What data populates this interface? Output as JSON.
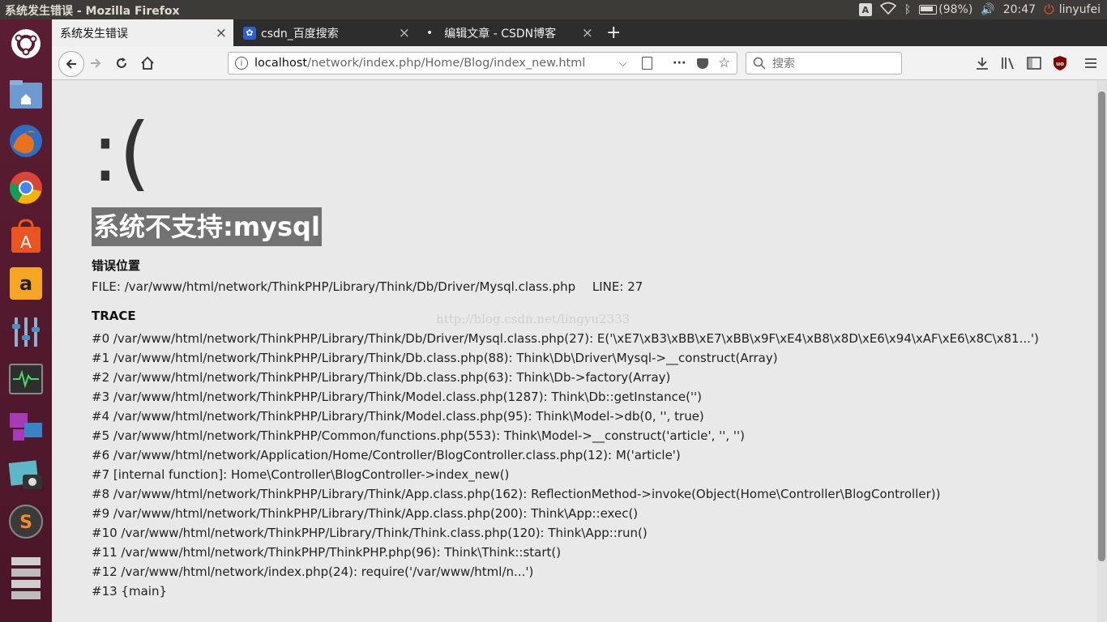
{
  "window": {
    "title": "系统发生错误 - Mozilla Firefox"
  },
  "tray": {
    "input": "A",
    "battery": "(98%)",
    "time": "20:47",
    "user": "linyufei"
  },
  "tabs": [
    {
      "label": "系统发生错误",
      "close": "×"
    },
    {
      "label": "csdn_百度搜索",
      "close": "×"
    },
    {
      "label": "编辑文章 - CSDN博客",
      "close": "×"
    }
  ],
  "newtab": "+",
  "url": {
    "host": "localhost",
    "path": "/network/index.php/Home/Blog/index_new.html"
  },
  "search": {
    "placeholder": "搜索"
  },
  "error": {
    "face": ":(",
    "message": "系统不支持:mysql",
    "location_label": "错误位置",
    "file": "FILE: /var/www/html/network/ThinkPHP/Library/Think/Db/Driver/Mysql.class.php",
    "line": "LINE: 27",
    "trace_label": "TRACE",
    "trace": [
      "#0 /var/www/html/network/ThinkPHP/Library/Think/Db/Driver/Mysql.class.php(27): E('\\xE7\\xB3\\xBB\\xE7\\xBB\\x9F\\xE4\\xB8\\x8D\\xE6\\x94\\xAF\\xE6\\x8C\\x81...')",
      "#1 /var/www/html/network/ThinkPHP/Library/Think/Db.class.php(88): Think\\Db\\Driver\\Mysql->__construct(Array)",
      "#2 /var/www/html/network/ThinkPHP/Library/Think/Db.class.php(63): Think\\Db->factory(Array)",
      "#3 /var/www/html/network/ThinkPHP/Library/Think/Model.class.php(1287): Think\\Db::getInstance('')",
      "#4 /var/www/html/network/ThinkPHP/Library/Think/Model.class.php(95): Think\\Model->db(0, '', true)",
      "#5 /var/www/html/network/ThinkPHP/Common/functions.php(553): Think\\Model->__construct('article', '', '')",
      "#6 /var/www/html/network/Application/Home/Controller/BlogController.class.php(12): M('article')",
      "#7 [internal function]: Home\\Controller\\BlogController->index_new()",
      "#8 /var/www/html/network/ThinkPHP/Library/Think/App.class.php(162): ReflectionMethod->invoke(Object(Home\\Controller\\BlogController))",
      "#9 /var/www/html/network/ThinkPHP/Library/Think/App.class.php(200): Think\\App::exec()",
      "#10 /var/www/html/network/ThinkPHP/Library/Think/Think.class.php(120): Think\\App::run()",
      "#11 /var/www/html/network/ThinkPHP/ThinkPHP.php(96): Think\\Think::start()",
      "#12 /var/www/html/network/index.php(24): require('/var/www/html/n...')",
      "#13 {main}"
    ]
  },
  "watermark": "http://blog.csdn.net/lingyu2333"
}
